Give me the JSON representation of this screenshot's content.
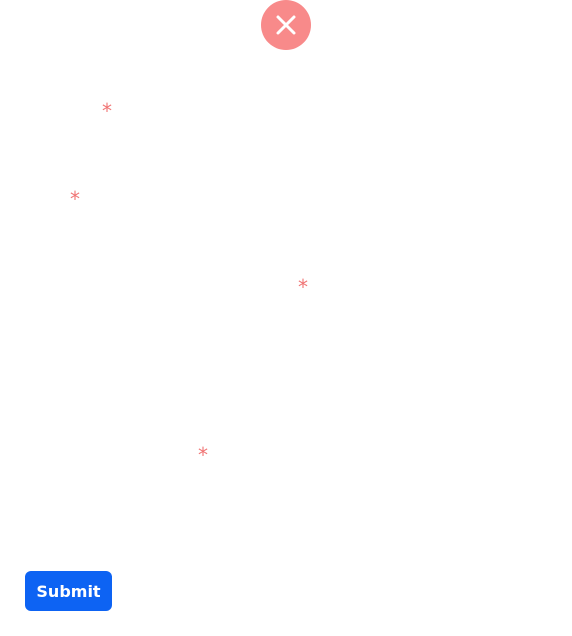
{
  "colors": {
    "close_circle": "#f88a8a",
    "required_star": "#f07575",
    "submit_bg": "#0d63f3",
    "submit_text": "#ffffff"
  },
  "close": {
    "icon": "close-icon"
  },
  "fields": [
    {
      "star": "*"
    },
    {
      "star": "*"
    },
    {
      "star": "*"
    },
    {
      "star": "*"
    }
  ],
  "submit": {
    "label": "Submit"
  }
}
